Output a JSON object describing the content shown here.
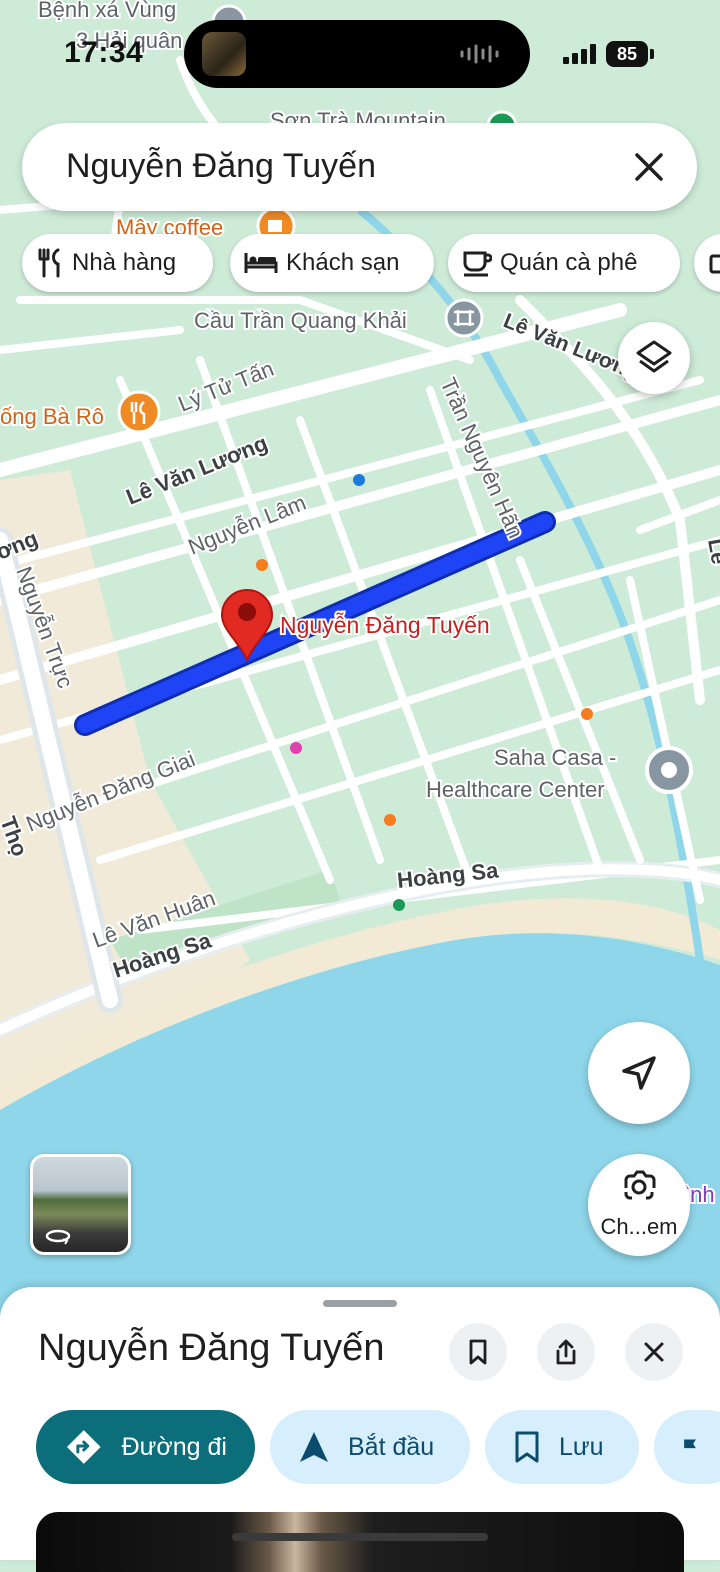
{
  "status_bar": {
    "time": "17:34",
    "battery": "85"
  },
  "search": {
    "query": "Nguyễn Đăng Tuyến"
  },
  "chips": [
    {
      "label": "Nhà hàng",
      "icon": "restaurant-icon"
    },
    {
      "label": "Khách sạn",
      "icon": "hotel-icon"
    },
    {
      "label": "Quán cà phê",
      "icon": "coffee-icon"
    }
  ],
  "map": {
    "labels": {
      "benh_xa": "Bệnh xá Vùng",
      "hai_quan": "3 Hải quân",
      "son_tra": "Sơn Trà Mountain",
      "may_coffee": "Mây coffee",
      "cau": "Cầu Trần Quang Khải",
      "le_van_luong_top": "Lê Văn Lương",
      "ly_tu_tan": "Lý Tử Tấn",
      "ba_ro": "ống Bà Rô",
      "le_van_luong": "Lê Văn Lương",
      "tran_nguyen_han": "Trần Nguyên Hãn",
      "nguyen_lam": "Nguyễn Lâm",
      "ong_left": "ơng",
      "nguyen_truc": "Nguyễn Trực",
      "pin_label": "Nguyễn Đăng Tuyến",
      "nguyen_dang_giai": "Nguyễn Đăng Giai",
      "saha_1": "Saha Casa -",
      "saha_2": "Healthcare Center",
      "tho": "Thọ",
      "hoang_sa_1": "Hoàng Sa",
      "le_van_huan": "Lê Văn Huân",
      "hoang_sa_2": "Hoàng Sa",
      "inh": "ình",
      "le_right": "Lê"
    },
    "colors": {
      "land": "#cdebd7",
      "road": "#ffffff",
      "water": "#8fd6ea",
      "sand": "#f1ead8",
      "route": "#1a3ef0",
      "pin": "#e02a22"
    }
  },
  "lens": {
    "label": "Ch...em"
  },
  "sheet": {
    "title": "Nguyễn Đăng Tuyến",
    "actions": [
      {
        "label": "Đường đi",
        "icon": "directions-icon"
      },
      {
        "label": "Bắt đầu",
        "icon": "navigation-arrow-icon"
      },
      {
        "label": "Lưu",
        "icon": "bookmark-icon"
      }
    ]
  }
}
